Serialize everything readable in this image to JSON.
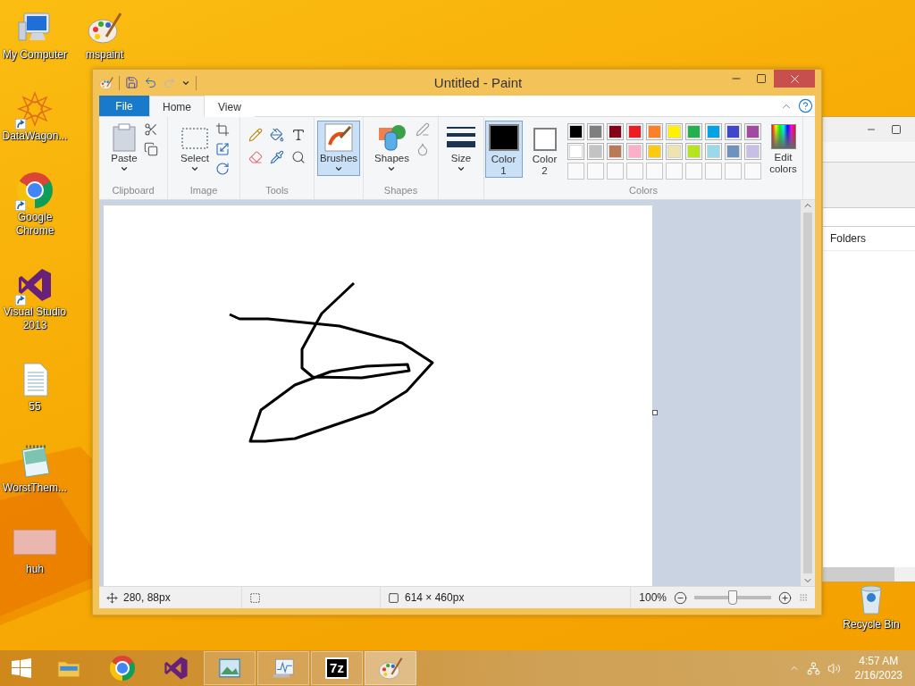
{
  "desktop": {
    "icons": [
      {
        "kind": "computer",
        "label": "My Computer",
        "shortcut": false
      },
      {
        "kind": "ornament",
        "label": "DataWagon...",
        "shortcut": true
      },
      {
        "kind": "chrome",
        "label": "Google Chrome",
        "shortcut": true
      },
      {
        "kind": "studio",
        "label": "Visual Studio 2013",
        "shortcut": true
      },
      {
        "kind": "textfile",
        "label": "55",
        "shortcut": false
      },
      {
        "kind": "notepad",
        "label": "WorstThem...",
        "shortcut": false
      },
      {
        "kind": "photo",
        "label": "huh",
        "shortcut": false
      }
    ],
    "paint_shortcut": {
      "label": "mspaint"
    },
    "recycle_bin": {
      "label": "Recycle Bin"
    }
  },
  "explorer": {
    "folders_header": "Folders"
  },
  "paint": {
    "title": "Untitled - Paint",
    "file_tab": "File",
    "tabs": [
      {
        "label": "Home",
        "selected": true
      },
      {
        "label": "View",
        "selected": false
      }
    ],
    "ribbon": {
      "groups": [
        {
          "kind": "clipboard",
          "label": "Clipboard",
          "button": "Paste"
        },
        {
          "kind": "image",
          "label": "Image",
          "button": "Select"
        },
        {
          "kind": "tools",
          "label": "Tools"
        },
        {
          "kind": "brushes",
          "button": "Brushes",
          "selected": true
        },
        {
          "kind": "shapes",
          "label": "Shapes",
          "button": "Shapes"
        },
        {
          "kind": "size",
          "button": "Size"
        }
      ],
      "colors": {
        "label": "Colors",
        "edit": "Edit colors",
        "slots": [
          {
            "label": "Color 1",
            "color": "#000000",
            "selected": true
          },
          {
            "label": "Color 2",
            "color": "#ffffff",
            "selected": false
          }
        ],
        "palette": [
          {
            "color": "#000000"
          },
          {
            "color": "#7f7f7f"
          },
          {
            "color": "#880015"
          },
          {
            "color": "#ed1c24"
          },
          {
            "color": "#ff7f27"
          },
          {
            "color": "#fff200"
          },
          {
            "color": "#22b14c"
          },
          {
            "color": "#00a2e8"
          },
          {
            "color": "#3f48cc"
          },
          {
            "color": "#a349a4"
          },
          {
            "color": "#ffffff"
          },
          {
            "color": "#c3c3c3"
          },
          {
            "color": "#b97a57"
          },
          {
            "color": "#ffaec9"
          },
          {
            "color": "#ffc90e"
          },
          {
            "color": "#efe4b0"
          },
          {
            "color": "#b5e61d"
          },
          {
            "color": "#99d9ea"
          },
          {
            "color": "#7092be"
          },
          {
            "color": "#c8bfe7"
          }
        ]
      }
    },
    "status_bar": {
      "position": "280, 88px",
      "size": "614 × 460px",
      "zoom": "100%",
      "zoom_slider": {
        "level": 0.5
      }
    }
  },
  "taskbar": {
    "items": [
      {
        "kind": "explorer",
        "running": false,
        "selected": false
      },
      {
        "kind": "chrome",
        "running": false,
        "selected": false
      },
      {
        "kind": "studio",
        "running": false,
        "selected": false
      },
      {
        "kind": "photos",
        "running": true,
        "selected": false
      },
      {
        "kind": "monitor",
        "running": true,
        "selected": false
      },
      {
        "kind": "archiver",
        "label": "7z",
        "running": true,
        "selected": false
      },
      {
        "kind": "paint",
        "running": true,
        "selected": true
      }
    ],
    "time": "4:57 AM",
    "date": "2/16/2023"
  }
}
